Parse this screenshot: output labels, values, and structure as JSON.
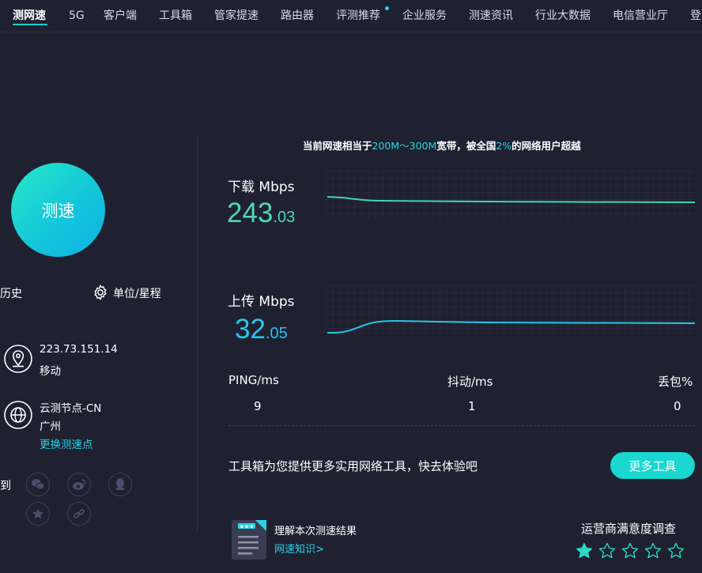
{
  "nav": {
    "items": [
      "测网速",
      "5G",
      "客户端",
      "工具箱",
      "管家提速",
      "路由器",
      "评测推荐",
      "企业服务",
      "测速资讯",
      "行业大数据",
      "电信营业厅",
      "登"
    ]
  },
  "left": {
    "speed_button": "测速",
    "history": "历史",
    "units": "单位/星程",
    "ip": "223.73.151.14",
    "isp": "移动",
    "node_name": "云测节点-CN",
    "node_city": "广州",
    "change_node": "更换测速点",
    "share_label": "到"
  },
  "headline": {
    "prefix": "当前网速相当于",
    "range": "200M～300M",
    "mid": "宽带，被全国",
    "percent": "2%",
    "suffix": "的网络用户超越"
  },
  "download": {
    "label": "下载 Mbps",
    "int": "243",
    "dec": ".03"
  },
  "upload": {
    "label": "上传 Mbps",
    "int": "32",
    "dec": ".05"
  },
  "stats": {
    "ping_label": "PING/ms",
    "ping_value": "9",
    "jitter_label": "抖动/ms",
    "jitter_value": "1",
    "loss_label": "丢包%",
    "loss_value": "0"
  },
  "tools": {
    "text": "工具箱为您提供更多实用网络工具，快去体验吧",
    "button": "更多工具"
  },
  "knowledge": {
    "title": "理解本次测速结果",
    "link": "网速知识>"
  },
  "survey": {
    "title": "运营商满意度调查",
    "rating": 1,
    "max": 5
  },
  "colors": {
    "accent": "#1ad7cf",
    "download_line": "#3fd6b4",
    "upload_line": "#27c3e6",
    "background": "#1f2131"
  },
  "icons": [
    "location-icon",
    "globe-icon",
    "gear-icon",
    "wechat-icon",
    "weibo-icon",
    "qq-icon",
    "star-badge-icon",
    "link-icon",
    "document-icon",
    "star-icon"
  ]
}
